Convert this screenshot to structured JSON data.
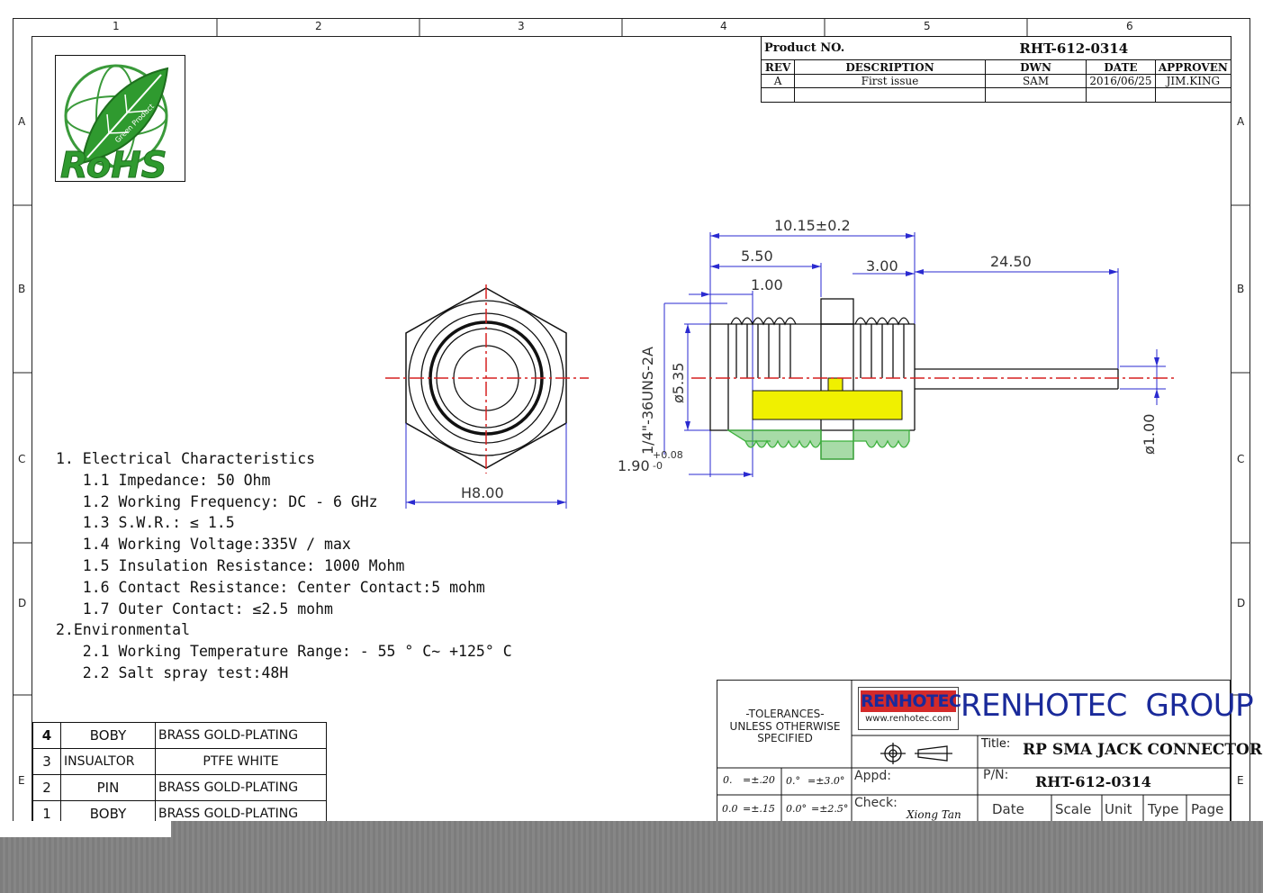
{
  "zones": {
    "cols": [
      "1",
      "2",
      "3",
      "4",
      "5",
      "6"
    ],
    "rows": [
      "A",
      "B",
      "C",
      "D",
      "E"
    ]
  },
  "rohs": {
    "main": "RoHS",
    "sub": "Green Product"
  },
  "revision_block": {
    "product_no_label": "Product NO.",
    "product_no": "RHT-612-0314",
    "headers": [
      "REV",
      "DESCRIPTION",
      "DWN",
      "DATE",
      "APPROVEN"
    ],
    "row": [
      "A",
      "First issue",
      "SAM",
      "2016/06/25",
      "JIM.KING"
    ]
  },
  "dimensions": {
    "overall": "10.15±0.2",
    "d1": "5.50",
    "d2": "1.00",
    "d3": "3.00",
    "pin_len": "24.50",
    "thread": "1/4\"-36UNS-2A",
    "dia": "ø5.35",
    "flange": "1.90",
    "flange_tol_plus": "+0.08",
    "flange_tol_minus": "-0",
    "pin_dia": "ø1.00",
    "hex": "H8.00"
  },
  "specs": [
    "1. Electrical Characteristics",
    "   1.1 Impedance: 50 Ohm",
    "   1.2 Working Frequency: DC - 6 GHz",
    "   1.3 S.W.R.: ≤ 1.5",
    "   1.4 Working Voltage:335V / max",
    "   1.5 Insulation Resistance: 1000 Mohm",
    "   1.6 Contact Resistance: Center Contact:5 mohm",
    "   1.7 Outer Contact: ≤2.5 mohm",
    "2.Environmental",
    "   2.1 Working Temperature Range: - 55 ° C~ +125° C",
    "   2.2 Salt spray test:48H"
  ],
  "bom": [
    {
      "no": "4",
      "part": "BOBY",
      "material": "BRASS GOLD-PLATING"
    },
    {
      "no": "3",
      "part": "INSUALTOR",
      "material": "PTFE WHITE"
    },
    {
      "no": "2",
      "part": "PIN",
      "material": "BRASS GOLD-PLATING"
    },
    {
      "no": "1",
      "part": "BOBY",
      "material": "BRASS GOLD-PLATING"
    }
  ],
  "title_block": {
    "tolerances": [
      "-TOLERANCES-",
      "UNLESS OTHERWISE",
      "SPECIFIED"
    ],
    "tol_rows": [
      [
        "0.",
        "=±.20",
        "0.°",
        "=±3.0°"
      ],
      [
        "0.0",
        "=±.15",
        "0.0°",
        "=±2.5°"
      ]
    ],
    "logo_text": "RENHOTEC",
    "logo_url": "www.renhotec.com",
    "company": "RENHOTEC  GROUP",
    "title_label": "Title:",
    "title": "RP SMA JACK CONNECTOR",
    "appd_label": "Appd:",
    "pn_label": "P/N:",
    "pn": "RHT-612-0314",
    "check_label": "Check:",
    "checker": "Xiong Tan",
    "footer_labels": [
      "Date",
      "Scale",
      "Unit",
      "Type",
      "Page"
    ]
  },
  "colors": {
    "center_line": "#d62020",
    "dimension": "#2a2ad0",
    "insulator": "#f0f000",
    "knurl_green": "#3bb03b"
  }
}
